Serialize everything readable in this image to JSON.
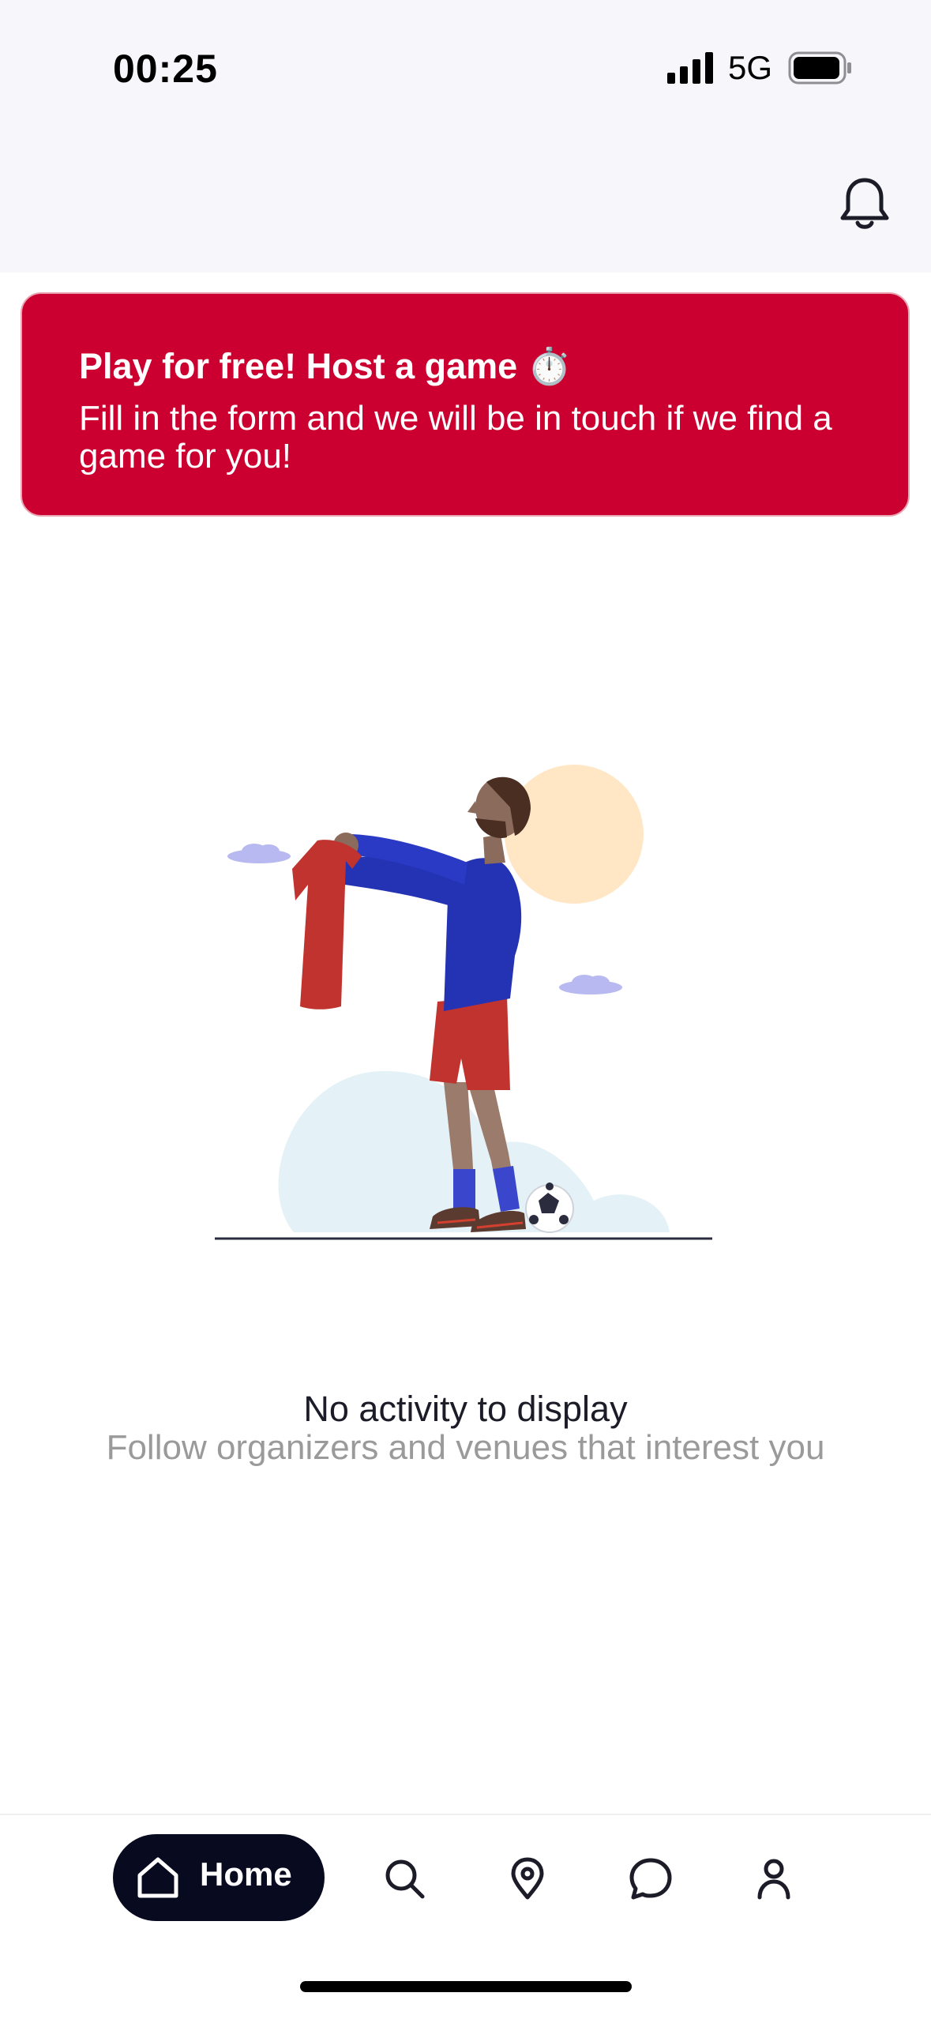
{
  "status_bar": {
    "time": "00:25",
    "network": "5G",
    "signal_icon": "signal-bars-icon",
    "battery_icon": "battery-icon"
  },
  "header": {
    "notification_icon": "bell-icon"
  },
  "promo_banner": {
    "title": "Play for free! Host a game ⏱️",
    "subtitle": "Fill in the form and we will be in touch if we find a game for you!",
    "background_color": "#cc0030"
  },
  "empty_state": {
    "illustration": "soccer-player-illustration",
    "title": "No activity to display",
    "subtitle": "Follow organizers and venues that interest you"
  },
  "tab_bar": {
    "home_label": "Home",
    "items": [
      {
        "icon": "home-icon",
        "selected": true
      },
      {
        "icon": "search-icon",
        "selected": false
      },
      {
        "icon": "map-pin-icon",
        "selected": false
      },
      {
        "icon": "chat-bubble-icon",
        "selected": false
      },
      {
        "icon": "profile-icon",
        "selected": false
      }
    ]
  },
  "colors": {
    "accent": "#cc0030",
    "nav_active": "#080a1f",
    "header_bg": "#f6f6fb"
  }
}
